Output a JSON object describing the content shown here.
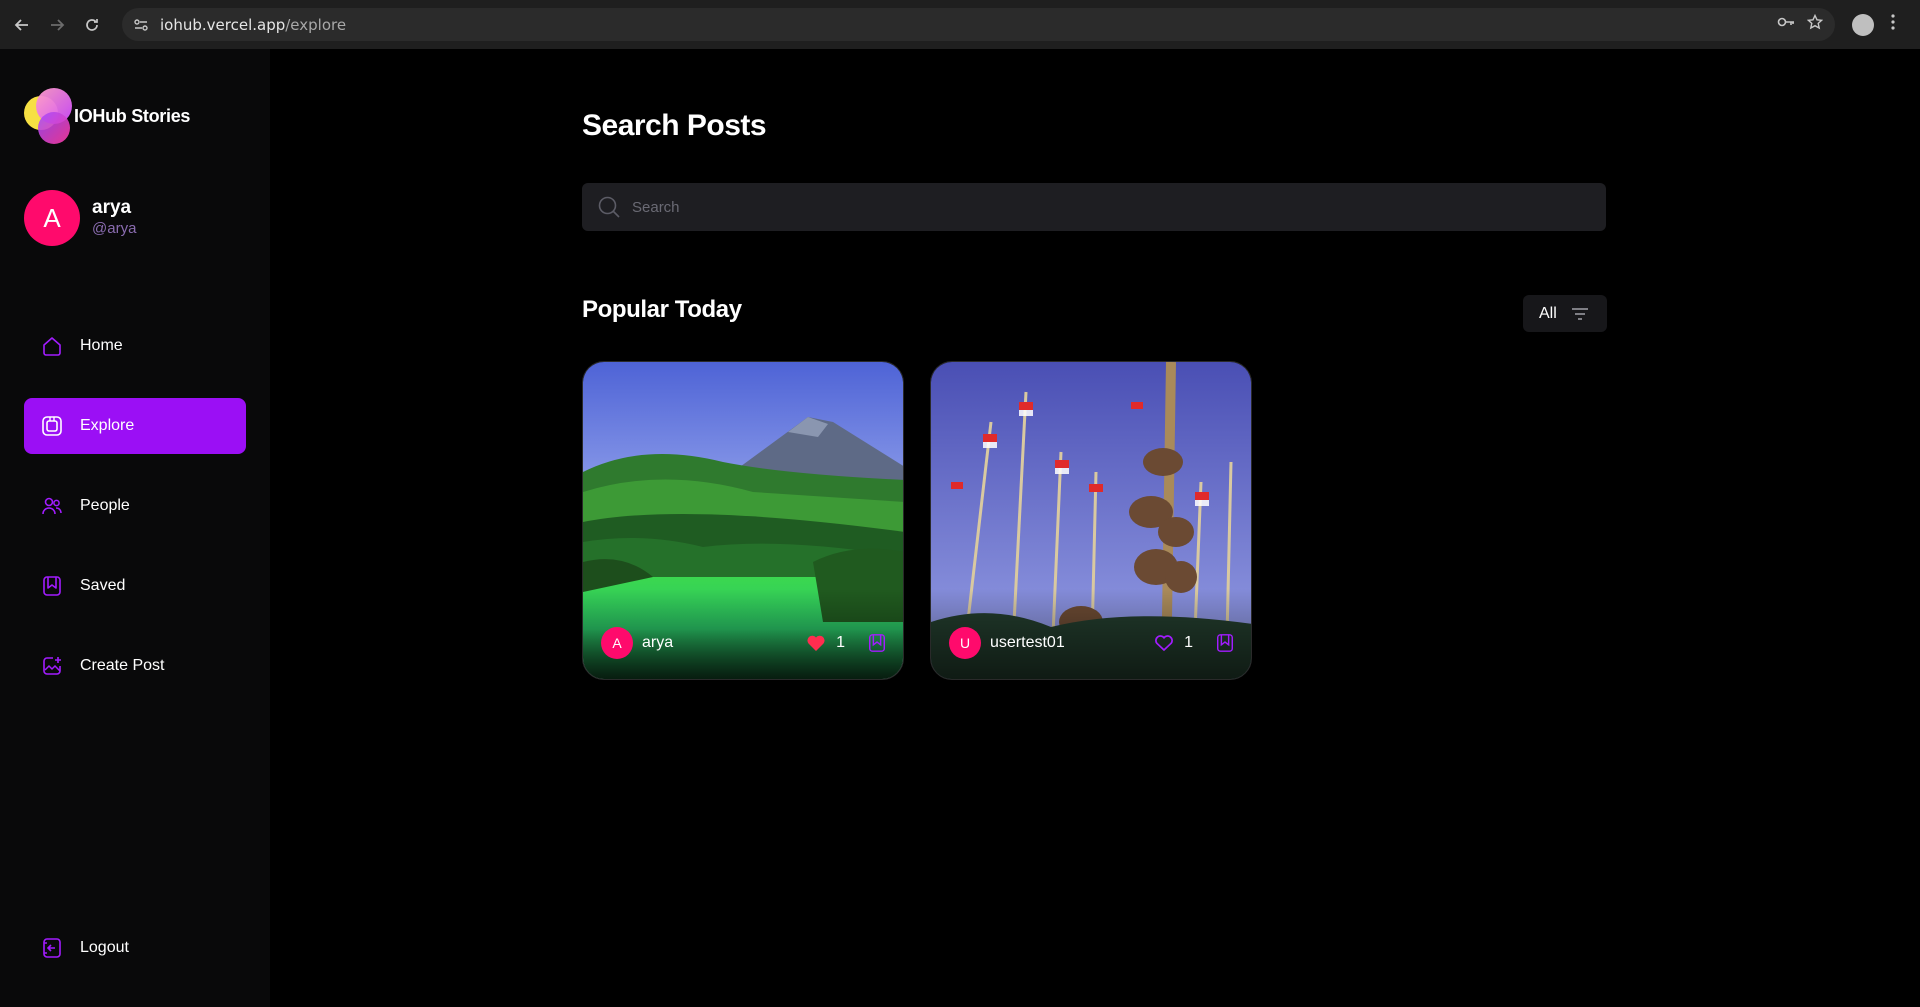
{
  "browser": {
    "url_host": "iohub.vercel.app",
    "url_path": "/explore"
  },
  "app": {
    "logo_text": "IOHub Stories",
    "brand_color": "#9b0ff5",
    "accent_pink": "#ff0a6c"
  },
  "user": {
    "initial": "A",
    "name": "arya",
    "handle": "@arya"
  },
  "nav": {
    "items": [
      {
        "label": "Home",
        "icon": "home-icon",
        "active": false
      },
      {
        "label": "Explore",
        "icon": "explore-icon",
        "active": true
      },
      {
        "label": "People",
        "icon": "people-icon",
        "active": false
      },
      {
        "label": "Saved",
        "icon": "bookmark-icon",
        "active": false
      },
      {
        "label": "Create Post",
        "icon": "create-post-icon",
        "active": false
      }
    ],
    "logout_label": "Logout"
  },
  "explore": {
    "title": "Search Posts",
    "search_placeholder": "Search",
    "section_title": "Popular Today",
    "filter_label": "All"
  },
  "posts": [
    {
      "author_initial": "A",
      "author": "arya",
      "likes": "1",
      "liked": true,
      "image": "landscape"
    },
    {
      "author_initial": "U",
      "author": "usertest01",
      "likes": "1",
      "liked": false,
      "image": "pole-climbing"
    }
  ]
}
